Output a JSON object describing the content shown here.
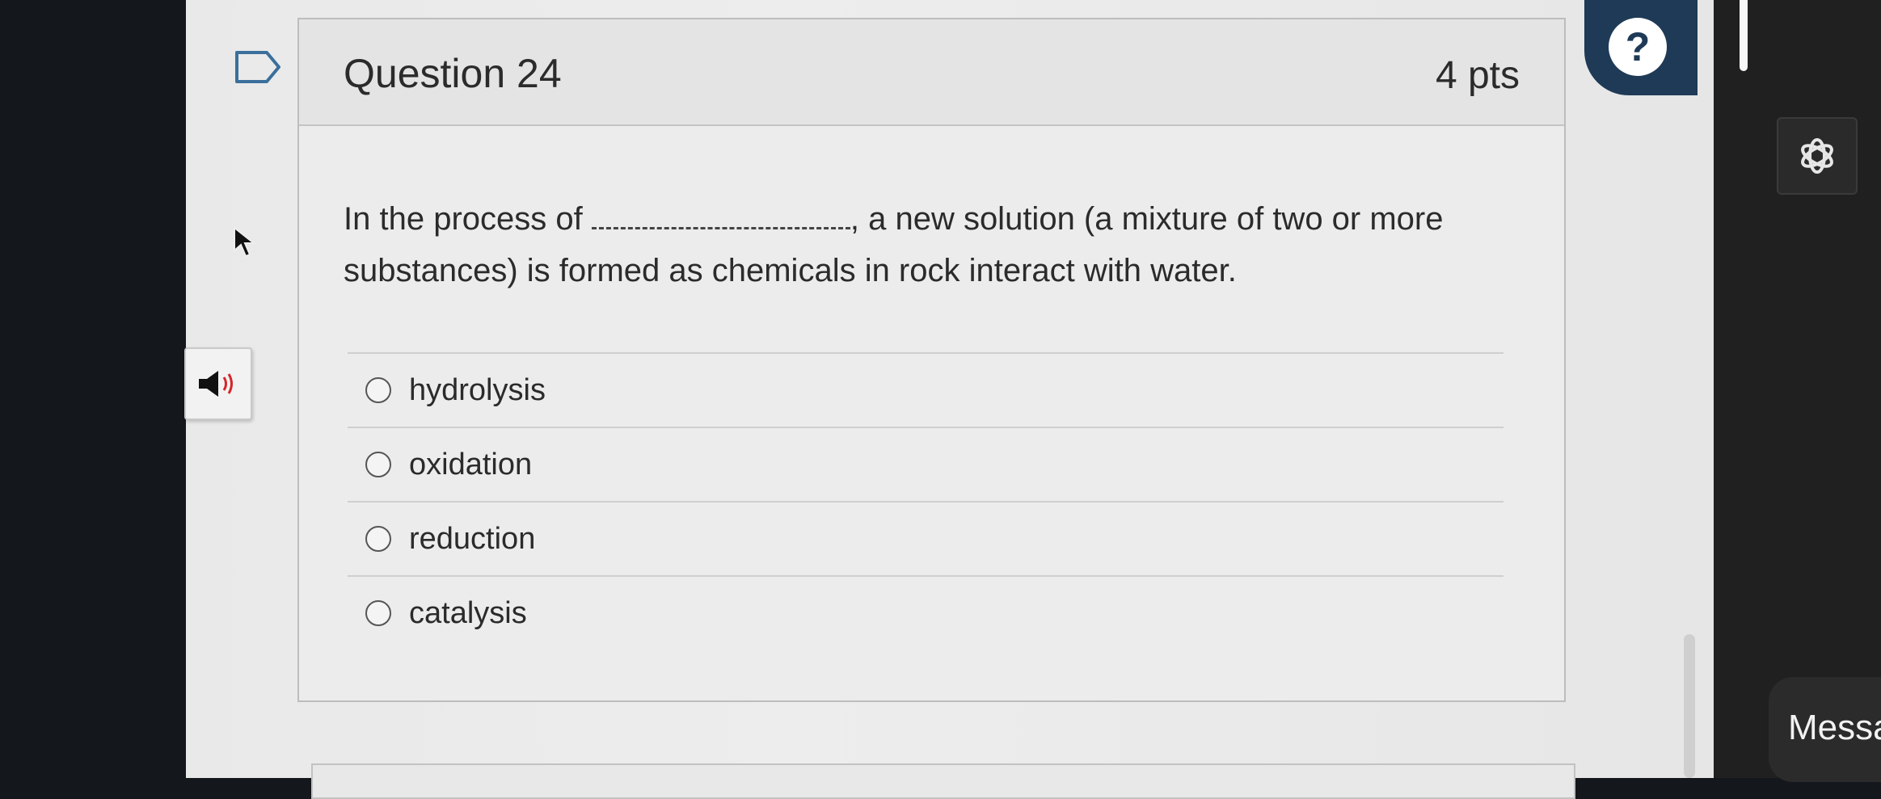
{
  "question": {
    "title": "Question 24",
    "points": "4 pts",
    "text_before": "In the process of",
    "text_after": ", a new solution (a mixture of two or more substances) is formed as chemicals in rock interact with water.",
    "options": [
      {
        "label": "hydrolysis"
      },
      {
        "label": "oxidation"
      },
      {
        "label": "reduction"
      },
      {
        "label": "catalysis"
      }
    ]
  },
  "help": {
    "symbol": "?"
  },
  "side_panel": {
    "message_label": "Messa"
  },
  "icons": {
    "flag": "flag-icon",
    "cursor": "cursor-arrow-icon",
    "audio": "speaker-icon",
    "assistant": "openai-logo-icon"
  },
  "colors": {
    "help_tab": "#1e3a56",
    "page_bg": "#ececec",
    "text": "#2b2b2b"
  }
}
